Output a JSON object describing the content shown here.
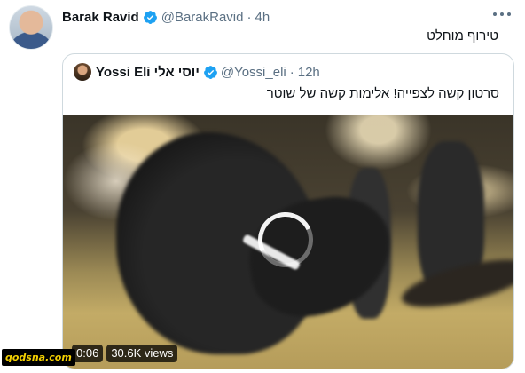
{
  "tweet": {
    "author_name": "Barak Ravid",
    "handle": "@BarakRavid",
    "separator": "·",
    "time": "4h",
    "text": "טירוף מוחלט",
    "avatar_icon": "user-avatar"
  },
  "quoted_tweet": {
    "author_name": "Yossi Eli יוסי אלי",
    "handle": "@Yossi_eli",
    "separator": "·",
    "time": "12h",
    "text": "סרטון קשה לצפייה! אלימות קשה של שוטר",
    "video": {
      "duration": "0:06",
      "views": "30.6K views"
    }
  },
  "watermark": "qodsna.com",
  "colors": {
    "verified_blue": "#1da1f2",
    "secondary_text": "#5b7083",
    "border": "#cfd9de",
    "watermark_yellow": "#f4d000"
  }
}
